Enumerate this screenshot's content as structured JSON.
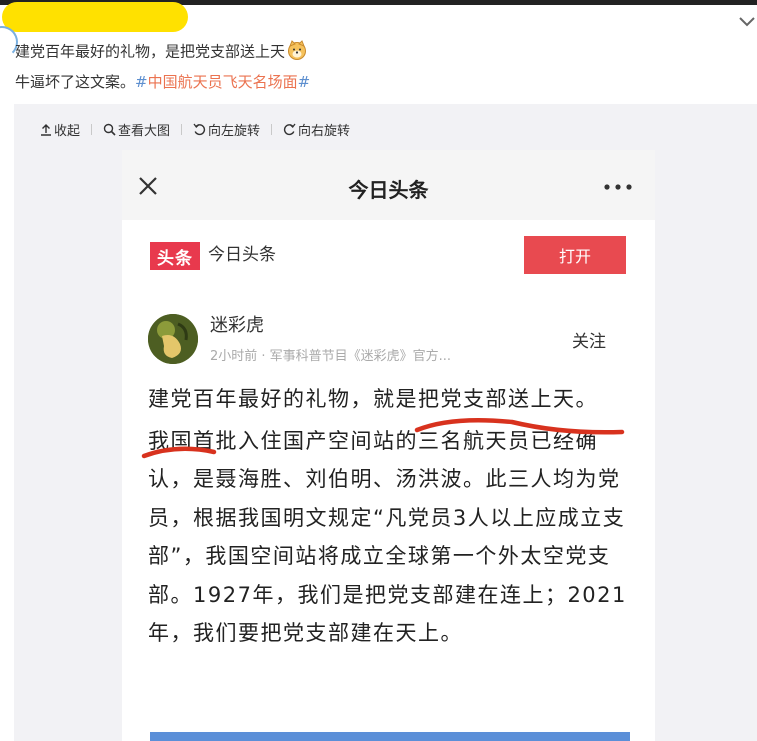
{
  "post": {
    "line1": "建党百年最好的礼物，是把党支部送上天",
    "line2_prefix": "牛逼坏了这文案。",
    "hash_open": "#",
    "hashtag": "中国航天员飞天名场面",
    "hash_close": "#",
    "emoji_icon": "doge-face-icon"
  },
  "toolbar": {
    "collapse": "收起",
    "view_large": "查看大图",
    "rotate_left": "向左旋转",
    "rotate_right": "向右旋转"
  },
  "screenshot": {
    "header_title": "今日头条",
    "logo_text": "头条",
    "app_name": "今日头条",
    "open_button": "打开",
    "author_name": "迷彩虎",
    "author_meta": "2小时前 · 军事科普节目《迷彩虎》官方...",
    "follow_button": "关注",
    "headline": "建党百年最好的礼物，就是把党支部送上天。",
    "body": "我国首批入住国产空间站的三名航天员已经确认，是聂海胜、刘伯明、汤洪波。此三人均为党员，根据我国明文规定“凡党员3人以上应成立支部”，我国空间站将成立全球第一个外太空党支部。1927年，我们是把党支部建在连上；2021年，我们要把党支部建在天上。"
  },
  "colors": {
    "highlight": "#ffe100",
    "hashtag": "#eb7350",
    "hash_mark": "#5d8fcf",
    "toutiao_red": "#e8394d",
    "underline_red": "#d8321e"
  }
}
